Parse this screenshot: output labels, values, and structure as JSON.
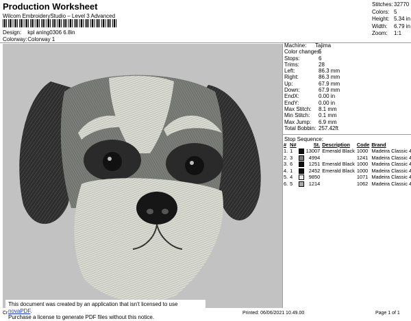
{
  "header": {
    "title": "Production Worksheet",
    "subtitle": "Wilcom EmbroideryStudio – Level 3 Advanced",
    "design_label": "Design:",
    "design_value": "kpl aning0306 6.8in",
    "colorway_label": "Colorway:",
    "colorway_value": "Colorway 1"
  },
  "stats": [
    {
      "label": "Stitches:",
      "value": "32770"
    },
    {
      "label": "Colors:",
      "value": "5"
    },
    {
      "label": "Height:",
      "value": "5.34 in"
    },
    {
      "label": "Width:",
      "value": "6.79 in"
    },
    {
      "label": "Zoom:",
      "value": "1:1"
    }
  ],
  "details": [
    {
      "label": "Machine:",
      "value": "Tajima"
    },
    {
      "label": "Color changes:",
      "value": "5"
    },
    {
      "label": "Stops:",
      "value": "6"
    },
    {
      "label": "Trims:",
      "value": "28"
    },
    {
      "label": "Left:",
      "value": "86.3 mm"
    },
    {
      "label": "Right:",
      "value": "86.3 mm"
    },
    {
      "label": "Up:",
      "value": "67.9 mm"
    },
    {
      "label": "Down:",
      "value": "67.9 mm"
    },
    {
      "label": "EndX:",
      "value": "0.00 in"
    },
    {
      "label": "EndY:",
      "value": "0.00 in"
    },
    {
      "label": "Max Stitch:",
      "value": "8.1 mm"
    },
    {
      "label": "Min Stitch:",
      "value": "0.1 mm"
    },
    {
      "label": "Max Jump:",
      "value": "6.9 mm"
    },
    {
      "label": "Total Bobbin:",
      "value": "257.42ft"
    }
  ],
  "sequence": {
    "heading": "Stop Sequence:",
    "columns": [
      "#",
      "N#",
      "St.",
      "Description",
      "Code",
      "Brand"
    ],
    "rows": [
      {
        "idx": "1.",
        "n": "1",
        "color": "#111111",
        "st": "13007",
        "desc": "Emerald Black",
        "code": "1000",
        "brand": "Madeira Classic 40"
      },
      {
        "idx": "2.",
        "n": "3",
        "color": "#7a7a7a",
        "st": "4994",
        "desc": "",
        "code": "1241",
        "brand": "Madeira Classic 40"
      },
      {
        "idx": "3.",
        "n": "6",
        "color": "#111111",
        "st": "1251",
        "desc": "Emerald Black",
        "code": "1000",
        "brand": "Madeira Classic 40"
      },
      {
        "idx": "4.",
        "n": "1",
        "color": "#111111",
        "st": "2452",
        "desc": "Emerald Black",
        "code": "1000",
        "brand": "Madeira Classic 40"
      },
      {
        "idx": "5.",
        "n": "4",
        "color": "#e6e6e2",
        "st": "9850",
        "desc": "",
        "code": "1071",
        "brand": "Madeira Classic 40"
      },
      {
        "idx": "6.",
        "n": "5",
        "color": "#a9a9a9",
        "st": "1214",
        "desc": "",
        "code": "1062",
        "brand": "Madeira Classic 40"
      }
    ]
  },
  "footer": {
    "left": "Cr",
    "printed": "Printed: 06/06/2021 10.49.00",
    "page": "Page 1 of 1"
  },
  "notice": {
    "line1_prefix": "This document was created by an application that isn't licensed to use ",
    "link": "novaPDF",
    "line1_suffix": ".",
    "line2": "Purchase a license to generate PDF files without this notice."
  }
}
